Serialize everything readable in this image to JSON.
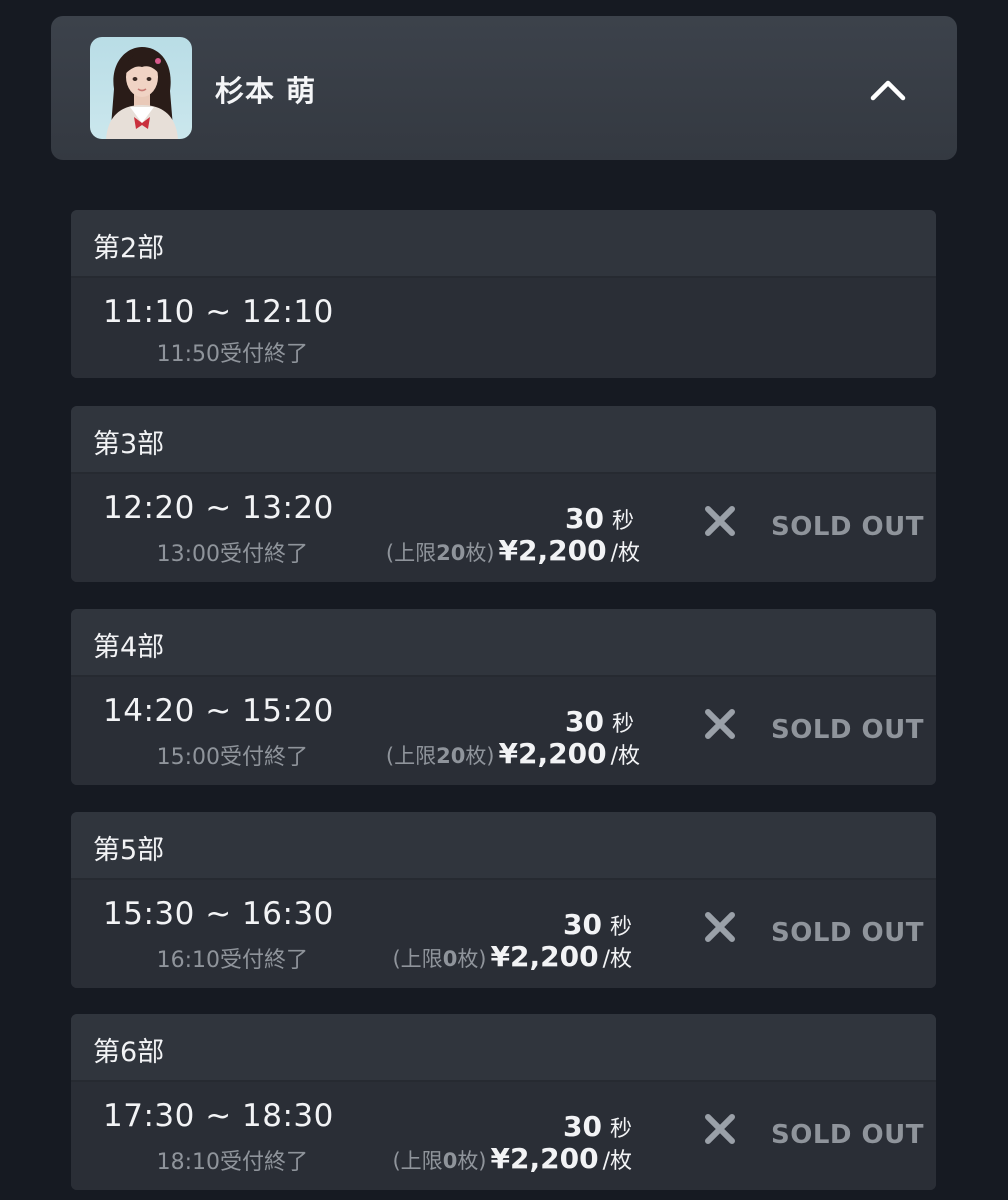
{
  "member": {
    "name": "杉本 萌"
  },
  "sessions": [
    {
      "title": "第2部",
      "time": "11:10 ~ 12:10",
      "deadline": "11:50受付終了"
    },
    {
      "title": "第3部",
      "time": "12:20 ~ 13:20",
      "deadline": "13:00受付終了",
      "duration": "30",
      "duration_unit": "秒",
      "limit_open": "(上限",
      "limit_num": "20",
      "limit_close": "枚)",
      "price": "¥2,200",
      "per": "/枚",
      "status": "SOLD OUT"
    },
    {
      "title": "第4部",
      "time": "14:20 ~ 15:20",
      "deadline": "15:00受付終了",
      "duration": "30",
      "duration_unit": "秒",
      "limit_open": "(上限",
      "limit_num": "20",
      "limit_close": "枚)",
      "price": "¥2,200",
      "per": "/枚",
      "status": "SOLD OUT"
    },
    {
      "title": "第5部",
      "time": "15:30 ~ 16:30",
      "deadline": "16:10受付終了",
      "duration": "30",
      "duration_unit": "秒",
      "limit_open": "(上限",
      "limit_num": "0",
      "limit_close": "枚)",
      "price": "¥2,200",
      "per": "/枚",
      "status": "SOLD OUT"
    },
    {
      "title": "第6部",
      "time": "17:30 ~ 18:30",
      "deadline": "18:10受付終了",
      "duration": "30",
      "duration_unit": "秒",
      "limit_open": "(上限",
      "limit_num": "0",
      "limit_close": "枚)",
      "price": "¥2,200",
      "per": "/枚",
      "status": "SOLD OUT"
    }
  ],
  "colors": {
    "background": "#161a22",
    "card": "#2b2f37",
    "muted_text": "#8f949b",
    "text": "#f2f3f5"
  },
  "icons": {
    "collapse": "chevron-up-icon",
    "unavailable": "close-icon"
  }
}
